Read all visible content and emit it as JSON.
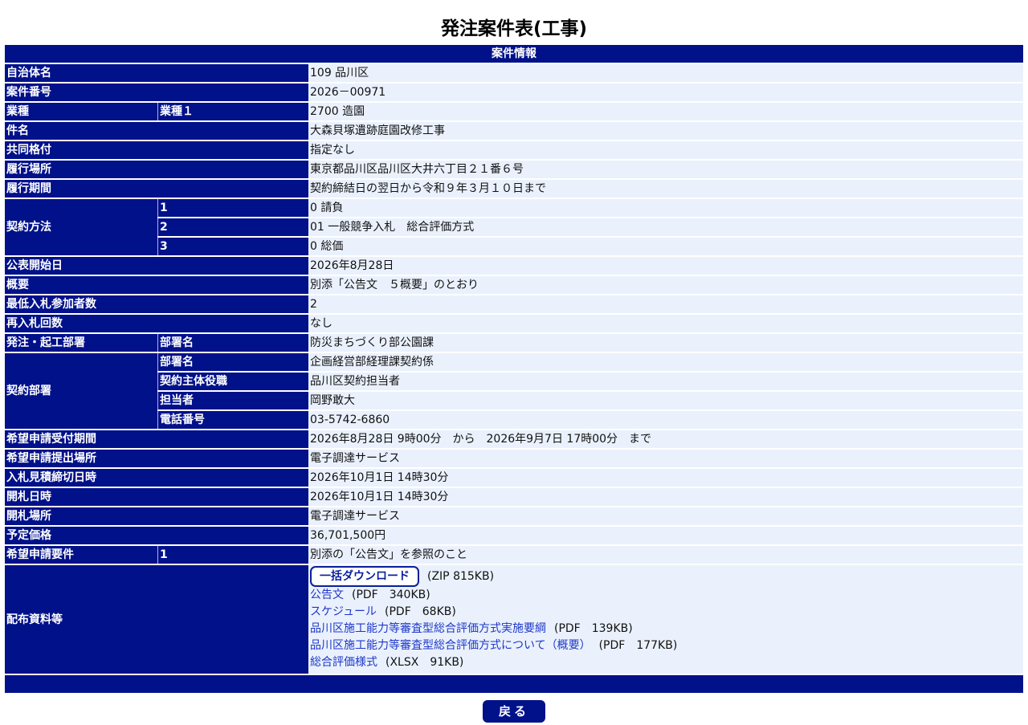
{
  "page_title": "発注案件表(工事)",
  "section_title": "案件情報",
  "rows": {
    "municipality": {
      "label": "自治体名",
      "value": "109 品川区"
    },
    "case_number": {
      "label": "案件番号",
      "value": "2026－00971"
    },
    "industry": {
      "label": "業種",
      "sublabel": "業種１",
      "value": "2700 造園"
    },
    "title": {
      "label": "件名",
      "value": "大森貝塚遺跡庭園改修工事"
    },
    "joint_rating": {
      "label": "共同格付",
      "value": "指定なし"
    },
    "location": {
      "label": "履行場所",
      "value": "東京都品川区品川区大井六丁目２１番６号"
    },
    "period": {
      "label": "履行期間",
      "value": "契約締結日の翌日から令和９年３月１０日まで"
    },
    "contract_method": {
      "label": "契約方法",
      "items": [
        {
          "sublabel": "1",
          "value": "0 請負"
        },
        {
          "sublabel": "2",
          "value": "01 一般競争入札　総合評価方式"
        },
        {
          "sublabel": "3",
          "value": "0 総価"
        }
      ]
    },
    "publish_date": {
      "label": "公表開始日",
      "value": "2026年8月28日"
    },
    "summary": {
      "label": "概要",
      "value": "別添「公告文　５概要」のとおり"
    },
    "min_bidders": {
      "label": "最低入札参加者数",
      "value": "2"
    },
    "rebid_count": {
      "label": "再入札回数",
      "value": "なし"
    },
    "ordering_dept": {
      "label": "発注・起工部署",
      "sublabel": "部署名",
      "value": "防災まちづくり部公園課"
    },
    "contract_dept": {
      "label": "契約部署",
      "items": [
        {
          "sublabel": "部署名",
          "value": "企画経営部経理課契約係"
        },
        {
          "sublabel": "契約主体役職",
          "value": "品川区契約担当者"
        },
        {
          "sublabel": "担当者",
          "value": "岡野敢大"
        },
        {
          "sublabel": "電話番号",
          "value": "03-5742-6860"
        }
      ]
    },
    "application_period": {
      "label": "希望申請受付期間",
      "value": "2026年8月28日 9時00分　から　2026年9月7日 17時00分　まで"
    },
    "application_place": {
      "label": "希望申請提出場所",
      "value": "電子調達サービス"
    },
    "bid_deadline": {
      "label": "入札見積締切日時",
      "value": "2026年10月1日 14時30分"
    },
    "opening_datetime": {
      "label": "開札日時",
      "value": "2026年10月1日 14時30分"
    },
    "opening_place": {
      "label": "開札場所",
      "value": "電子調達サービス"
    },
    "estimated_price": {
      "label": "予定価格",
      "value": "36,701,500円"
    },
    "application_requirements": {
      "label": "希望申請要件",
      "sublabel": "1",
      "value": "別添の「公告文」を参照のこと"
    },
    "documents": {
      "label": "配布資料等",
      "download_all": {
        "label": "一括ダウンロード",
        "meta": "(ZIP 815KB)"
      },
      "files": [
        {
          "name": "公告文",
          "meta": "(PDF　340KB)"
        },
        {
          "name": "スケジュール",
          "meta": "(PDF　68KB)"
        },
        {
          "name": "品川区施工能力等審査型総合評価方式実施要綱",
          "meta": "(PDF　139KB)"
        },
        {
          "name": "品川区施工能力等審査型総合評価方式について（概要）",
          "meta": "(PDF　177KB)"
        },
        {
          "name": "総合評価様式",
          "meta": "(XLSX　91KB)"
        }
      ]
    }
  },
  "back_button": "戻る",
  "colors": {
    "header_bg": "#00118a",
    "value_bg": "#eaf1fd",
    "link": "#1d37c8"
  }
}
